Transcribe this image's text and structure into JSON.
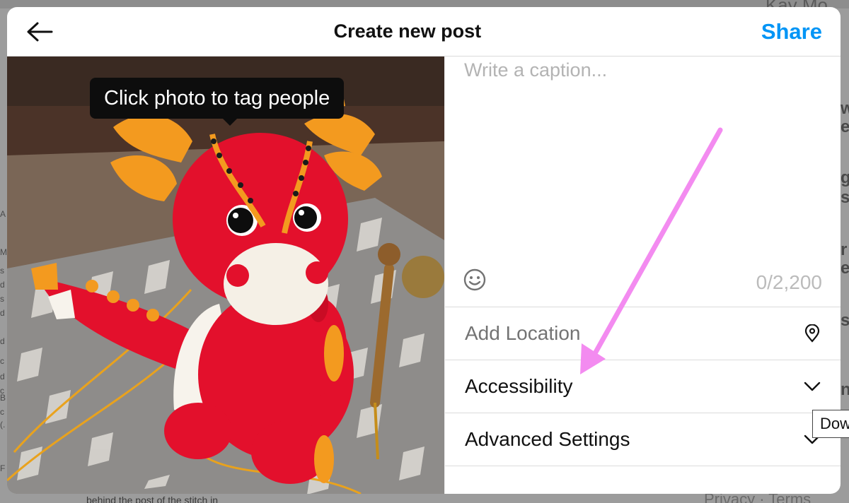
{
  "background": {
    "profile_name": "Kay Mo",
    "right_letters": [
      "w",
      "e",
      "g",
      "s",
      "r",
      "e",
      "s",
      "n"
    ],
    "left_letters": [
      "A",
      "M",
      "s",
      "d",
      "s",
      "d",
      "d",
      "c",
      "d",
      "c",
      "B",
      "c",
      "(.",
      "F"
    ],
    "bottom_text": "behind the post of the stitch in",
    "footer_text": "Privacy · Terms",
    "hover_tooltip": "Dow"
  },
  "modal": {
    "back_icon": "arrow-left-icon",
    "title": "Create new post",
    "share_label": "Share",
    "photo_tooltip": "Click photo to tag people",
    "caption": {
      "placeholder": "Write a caption...",
      "value": "",
      "char_count": "0/2,200",
      "emoji_icon": "smiley-icon"
    },
    "rows": [
      {
        "label": "Add Location",
        "icon": "location-pin-icon"
      },
      {
        "label": "Accessibility",
        "icon": "chevron-down-icon"
      },
      {
        "label": "Advanced Settings",
        "icon": "chevron-down-icon"
      }
    ]
  },
  "annotation": {
    "arrow_color": "#f38bf0"
  },
  "colors": {
    "accent": "#0095f6",
    "dragon_red": "#e3102c",
    "dragon_orange": "#f39a1f"
  }
}
